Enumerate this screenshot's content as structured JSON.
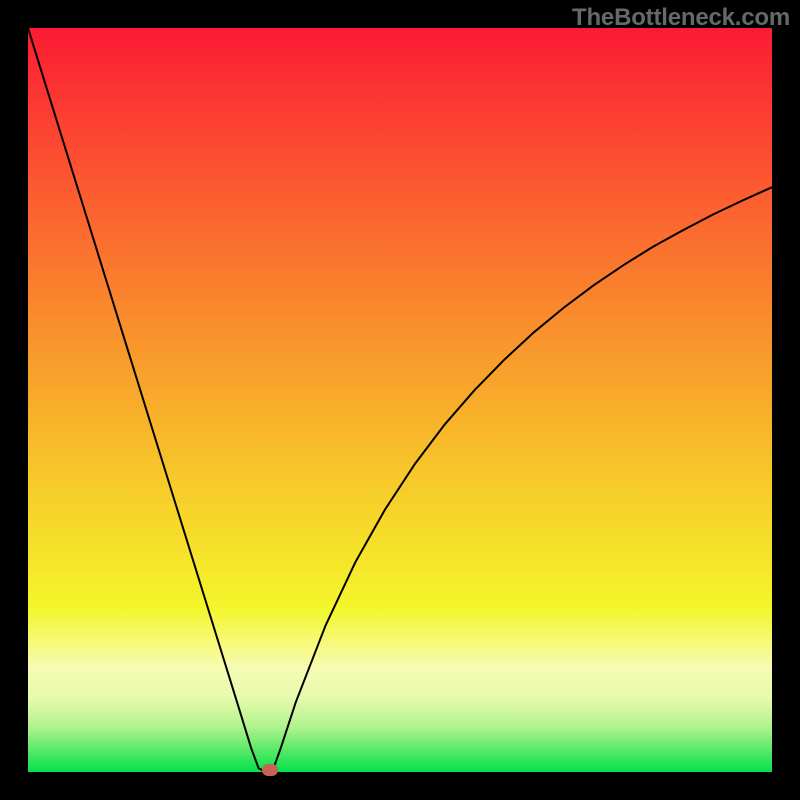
{
  "watermark": "TheBottleneck.com",
  "chart_data": {
    "type": "line",
    "title": "",
    "xlabel": "",
    "ylabel": "",
    "xlim": [
      0,
      100
    ],
    "ylim": [
      0,
      100
    ],
    "series": [
      {
        "name": "bottleneck-curve",
        "x": [
          0,
          4,
          8,
          12,
          16,
          20,
          24,
          28,
          30,
          31,
          32,
          33,
          34,
          36,
          40,
          44,
          48,
          52,
          56,
          60,
          64,
          68,
          72,
          76,
          80,
          84,
          88,
          92,
          96,
          100
        ],
        "values": [
          100,
          87.1,
          74.2,
          61.3,
          48.4,
          35.5,
          22.6,
          9.7,
          3.2,
          0.5,
          0,
          0.5,
          3.3,
          9.4,
          19.7,
          28.2,
          35.3,
          41.4,
          46.7,
          51.3,
          55.4,
          59.1,
          62.4,
          65.4,
          68.1,
          70.6,
          72.8,
          74.9,
          76.8,
          78.6
        ]
      }
    ],
    "marker": {
      "x": 32.5,
      "y": 0
    },
    "background_gradient": {
      "stops": [
        {
          "pos": 0.0,
          "color": "#fb1b34"
        },
        {
          "pos": 0.2,
          "color": "#fc5631"
        },
        {
          "pos": 0.4,
          "color": "#f98f2c"
        },
        {
          "pos": 0.6,
          "color": "#f7c72a"
        },
        {
          "pos": 0.78,
          "color": "#f4f62b"
        },
        {
          "pos": 0.86,
          "color": "#f7fbb3"
        },
        {
          "pos": 0.9,
          "color": "#e7faae"
        },
        {
          "pos": 0.94,
          "color": "#aff38c"
        },
        {
          "pos": 0.97,
          "color": "#59e968"
        },
        {
          "pos": 1.0,
          "color": "#05e04c"
        }
      ]
    }
  }
}
